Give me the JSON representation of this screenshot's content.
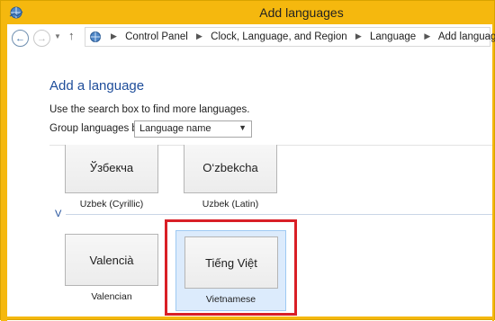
{
  "window": {
    "title": "Add languages",
    "app_icon": "control-panel-globe-icon"
  },
  "nav": {
    "back_icon": "back-arrow-icon",
    "forward_icon": "forward-arrow-icon",
    "recent_icon": "chevron-down-icon",
    "up_icon": "up-arrow-icon"
  },
  "breadcrumb": {
    "items": [
      "Control Panel",
      "Clock, Language, and Region",
      "Language",
      "Add languages"
    ]
  },
  "main": {
    "heading": "Add a language",
    "description": "Use the search box to find more languages.",
    "group_by_label": "Group languages by:",
    "group_by_value": "Language name"
  },
  "languages": {
    "group_v_letter": "V",
    "uzbek_cyrillic": {
      "native": "Ўзбекча",
      "english": "Uzbek (Cyrillic)"
    },
    "uzbek_latin": {
      "native": "O‘zbekcha",
      "english": "Uzbek (Latin)"
    },
    "valencian": {
      "native": "Valencià",
      "english": "Valencian"
    },
    "vietnamese": {
      "native": "Tiếng Việt",
      "english": "Vietnamese"
    }
  },
  "colors": {
    "titlebar": "#f5b80e",
    "heading": "#1e4d9a",
    "selection": "#dcebfc",
    "highlight": "#d91f26"
  }
}
